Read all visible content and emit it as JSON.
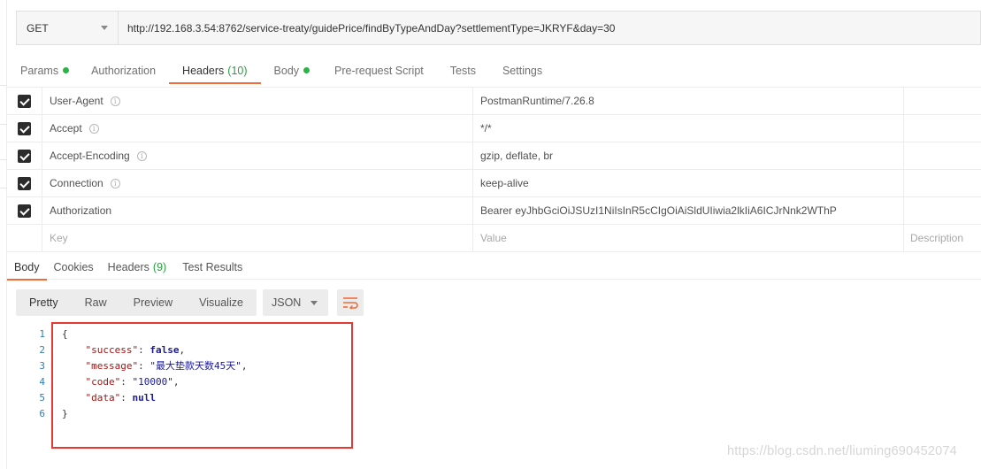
{
  "request": {
    "method": "GET",
    "url": "http://192.168.3.54:8762/service-treaty/guidePrice/findByTypeAndDay?settlementType=JKRYF&day=30"
  },
  "request_tabs": [
    {
      "label": "Params",
      "dot": true
    },
    {
      "label": "Authorization"
    },
    {
      "label": "Headers",
      "count": "(10)",
      "active": true
    },
    {
      "label": "Body",
      "dot": true
    },
    {
      "label": "Pre-request Script"
    },
    {
      "label": "Tests"
    },
    {
      "label": "Settings"
    }
  ],
  "headers": [
    {
      "key": "User-Agent",
      "value": "PostmanRuntime/7.26.8",
      "info": true
    },
    {
      "key": "Accept",
      "value": "*/*",
      "info": true
    },
    {
      "key": "Accept-Encoding",
      "value": "gzip, deflate, br",
      "info": true
    },
    {
      "key": "Connection",
      "value": "keep-alive",
      "info": true
    },
    {
      "key": "Authorization",
      "value": "Bearer eyJhbGciOiJSUzI1NiIsInR5cCIgOiAiSldUIiwia2lkIiA6ICJrNnk2WThP",
      "info": false
    }
  ],
  "headers_placeholders": {
    "key": "Key",
    "value": "Value",
    "description": "Description"
  },
  "response_tabs": [
    {
      "label": "Body",
      "active": true
    },
    {
      "label": "Cookies"
    },
    {
      "label": "Headers",
      "count": "(9)"
    },
    {
      "label": "Test Results"
    }
  ],
  "view_modes": [
    "Pretty",
    "Raw",
    "Preview",
    "Visualize"
  ],
  "format": "JSON",
  "code_lines": [
    {
      "n": "1",
      "text": "{"
    },
    {
      "n": "2",
      "key": "\"success\"",
      "value": "false",
      "kind": "b",
      "comma": ","
    },
    {
      "n": "3",
      "key": "\"message\"",
      "value": "\"最大垫款天数45天\"",
      "kind": "s",
      "comma": ","
    },
    {
      "n": "4",
      "key": "\"code\"",
      "value": "\"10000\"",
      "kind": "s",
      "comma": ","
    },
    {
      "n": "5",
      "key": "\"data\"",
      "value": "null",
      "kind": "b",
      "comma": ""
    },
    {
      "n": "6",
      "text": "}"
    }
  ],
  "watermark": "https://blog.csdn.net/liuming690452074",
  "colors": {
    "accent": "#f26b3a",
    "green": "#26b547",
    "highlight": "#e53935"
  }
}
